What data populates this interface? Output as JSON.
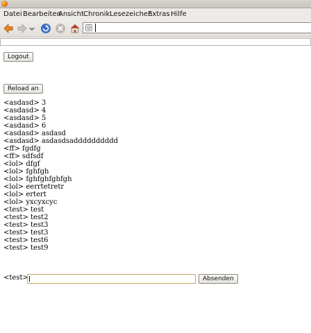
{
  "menu": [
    {
      "label": "Datei",
      "name": "menu-datei"
    },
    {
      "label": "Bearbeiten",
      "name": "menu-bearbeiten"
    },
    {
      "label": "Ansicht",
      "name": "menu-ansicht"
    },
    {
      "label": "Chronik",
      "name": "menu-chronik"
    },
    {
      "label": "Lesezeichen",
      "name": "menu-lesezeichen"
    },
    {
      "label": "Extras",
      "name": "menu-extras"
    },
    {
      "label": "Hilfe",
      "name": "menu-hilfe"
    }
  ],
  "url": {
    "value": ""
  },
  "buttons": {
    "logout": "Logout",
    "reload": "Reload an",
    "send": "Absenden"
  },
  "messages": [
    "<asdasd> 3",
    "<asdasd> 4",
    "<asdasd> 5",
    "<asdasd> 6",
    "<asdasd> asdasd",
    "<asdasd> asdasdsadddddddddd",
    "<ff> fgdfg",
    "<ff> sdfsdf",
    "<lol> dfgf",
    "<lol> fghfgh",
    "<lol> fghfghfghfgh",
    "<lol> eerrtetretr",
    "<lol> ertert",
    "<lol> yxcyxcyc",
    "<test> test",
    "<test> test2",
    "<test> test3",
    "<test> test3",
    "<test> test6",
    "<test> test9"
  ],
  "input": {
    "label": "<test>",
    "value": ""
  },
  "icons": {
    "back": "arrow-left-icon",
    "forward": "arrow-right-icon",
    "history_dropdown": "chevron-down-icon",
    "reload": "reload-icon",
    "stop": "stop-icon",
    "home": "home-icon",
    "favicon": "page-icon"
  },
  "colors": {
    "back_arrow": "#e8821e",
    "reload": "#3a6fc4",
    "input_border": "#c6a463"
  }
}
